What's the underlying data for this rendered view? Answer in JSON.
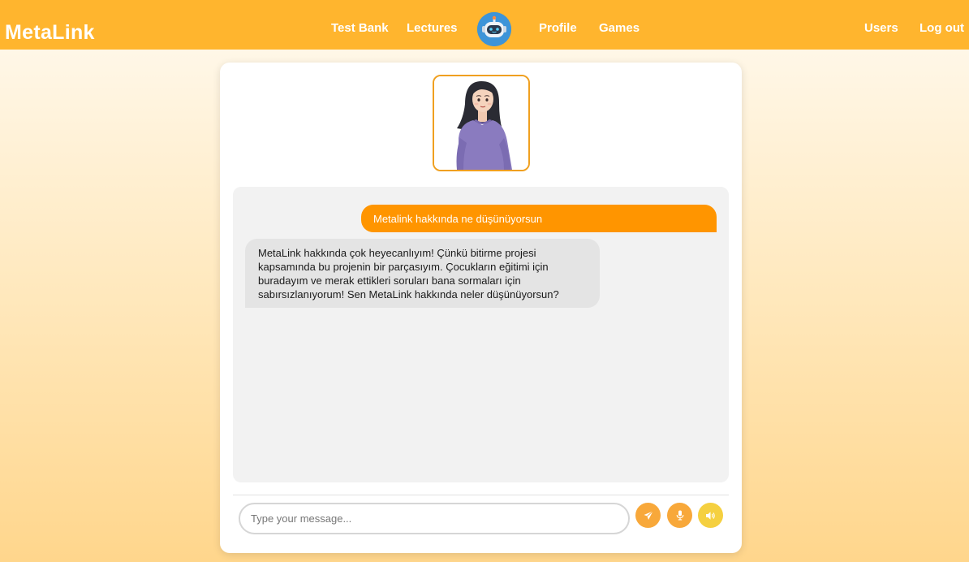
{
  "brand": "MetaLink",
  "nav": {
    "test_bank": "Test Bank",
    "lectures": "Lectures",
    "profile": "Profile",
    "games": "Games",
    "users": "Users",
    "logout": "Log out"
  },
  "chat": {
    "messages": [
      {
        "sender": "user",
        "text": "Metalink hakkında ne düşünüyorsun"
      },
      {
        "sender": "bot",
        "text": "MetaLink hakkında çok heyecanlıyım! Çünkü bitirme projesi kapsamında bu projenin bir parçasıyım. Çocukların eğitimi için buradayım ve merak ettikleri soruları bana sormaları için sabırsızlanıyorum! Sen MetaLink hakkında neler düşünüyorsun?"
      }
    ],
    "input_placeholder": "Type your message...",
    "input_value": ""
  },
  "icons": {
    "logo": "robot-icon",
    "send": "paper-plane-icon",
    "mic": "microphone-icon",
    "speaker": "speaker-icon"
  },
  "colors": {
    "navbar": "#ffb52e",
    "user_bubble": "#ff9500",
    "bot_bubble": "#e4e4e4",
    "send_button": "#f8a83a",
    "mic_button": "#f8a83a",
    "speaker_button": "#f5d040",
    "avatar_border": "#f0a020"
  }
}
